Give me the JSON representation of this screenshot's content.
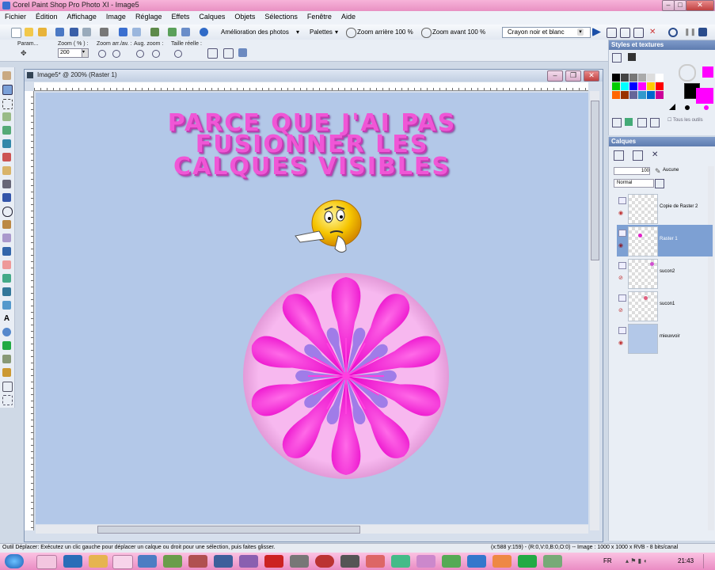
{
  "window": {
    "title": "Corel Paint Shop Pro Photo XI - Image5"
  },
  "menu": [
    "Fichier",
    "Édition",
    "Affichage",
    "Image",
    "Réglage",
    "Effets",
    "Calques",
    "Objets",
    "Sélections",
    "Fenêtre",
    "Aide"
  ],
  "toolbar": {
    "photo_enhance": "Amélioration des photos",
    "palettes": "Palettes",
    "zoom_out": "Zoom arrière 100 %",
    "zoom_in": "Zoom avant 100 %",
    "brush": "Crayon noir et blanc"
  },
  "options": {
    "params": "Param...",
    "zoom_label": "Zoom ( % ) :",
    "zoom_value": "200",
    "zoom_step_label": "Zoom arr./av. :",
    "zoom_increase_label": "Aug. zoom :",
    "actual_size_label": "Taille réelle :"
  },
  "document": {
    "title": "Image5* @ 200% (Raster 1)",
    "canvas_lines": [
      "PARCE QUE J'AI PAS",
      "FUSIONNER LES",
      "CALQUES VISIBLES"
    ]
  },
  "styles_panel": {
    "title": "Styles et textures",
    "all_tools": "Tous les outils",
    "fg_color": "#000000",
    "bg_color": "#ff00ff"
  },
  "layers_panel": {
    "title": "Calques",
    "opacity": "100",
    "blend_mode": "Normal",
    "mask": "Aucune",
    "layers": [
      {
        "name": "Copie de Raster 2"
      },
      {
        "name": "Raster 1"
      },
      {
        "name": "sucon2"
      },
      {
        "name": "sucon1"
      },
      {
        "name": "mieuxvoir"
      }
    ]
  },
  "status": {
    "message": "Outil Déplacer: Exécutez un clic gauche pour déplacer un calque ou droit pour une sélection, puis faites glisser.",
    "info": "(x:588 y:159) - (R:0,V:0,B:0,O:0) -- Image : 1000 x 1000 x RVB - 8 bits/canal"
  },
  "taskbar": {
    "lang": "FR",
    "time": "21:43"
  },
  "colors": {
    "accent": "#e890c2",
    "canvas": "#b3c8e8",
    "text_pink": "#f056d6",
    "flower_magenta": "#ff1ad4",
    "flower_light": "#f7b8ef",
    "flower_violet": "#a07ce8"
  }
}
